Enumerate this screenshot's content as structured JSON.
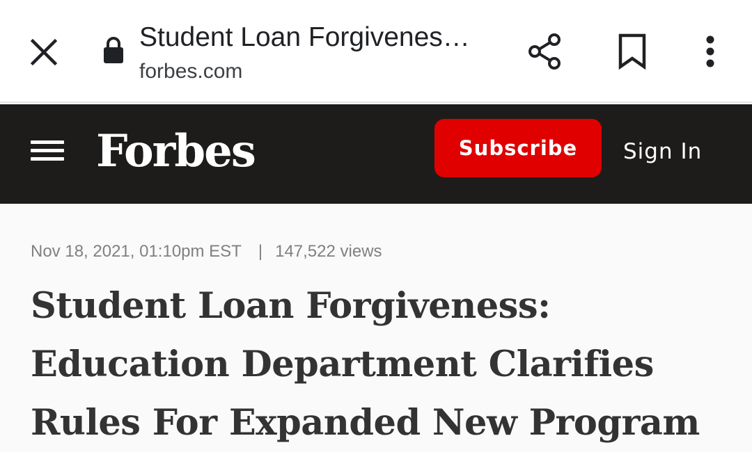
{
  "browser": {
    "page_title": "Student Loan Forgivenes…",
    "domain": "forbes.com",
    "icons": {
      "close": "close-icon",
      "lock": "lock-icon",
      "share": "share-icon",
      "bookmark": "bookmark-icon",
      "more": "more-vert-icon"
    }
  },
  "header": {
    "logo": "Forbes",
    "subscribe_label": "Subscribe",
    "signin_label": "Sign In",
    "colors": {
      "background": "#1d1c1b",
      "subscribe": "#e00000"
    }
  },
  "article": {
    "date": "Nov 18, 2021, 01:10pm EST",
    "separator": "|",
    "views": "147,522 views",
    "headline": "Student Loan Forgiveness: Education Department Clarifies Rules For Expanded New Program"
  }
}
